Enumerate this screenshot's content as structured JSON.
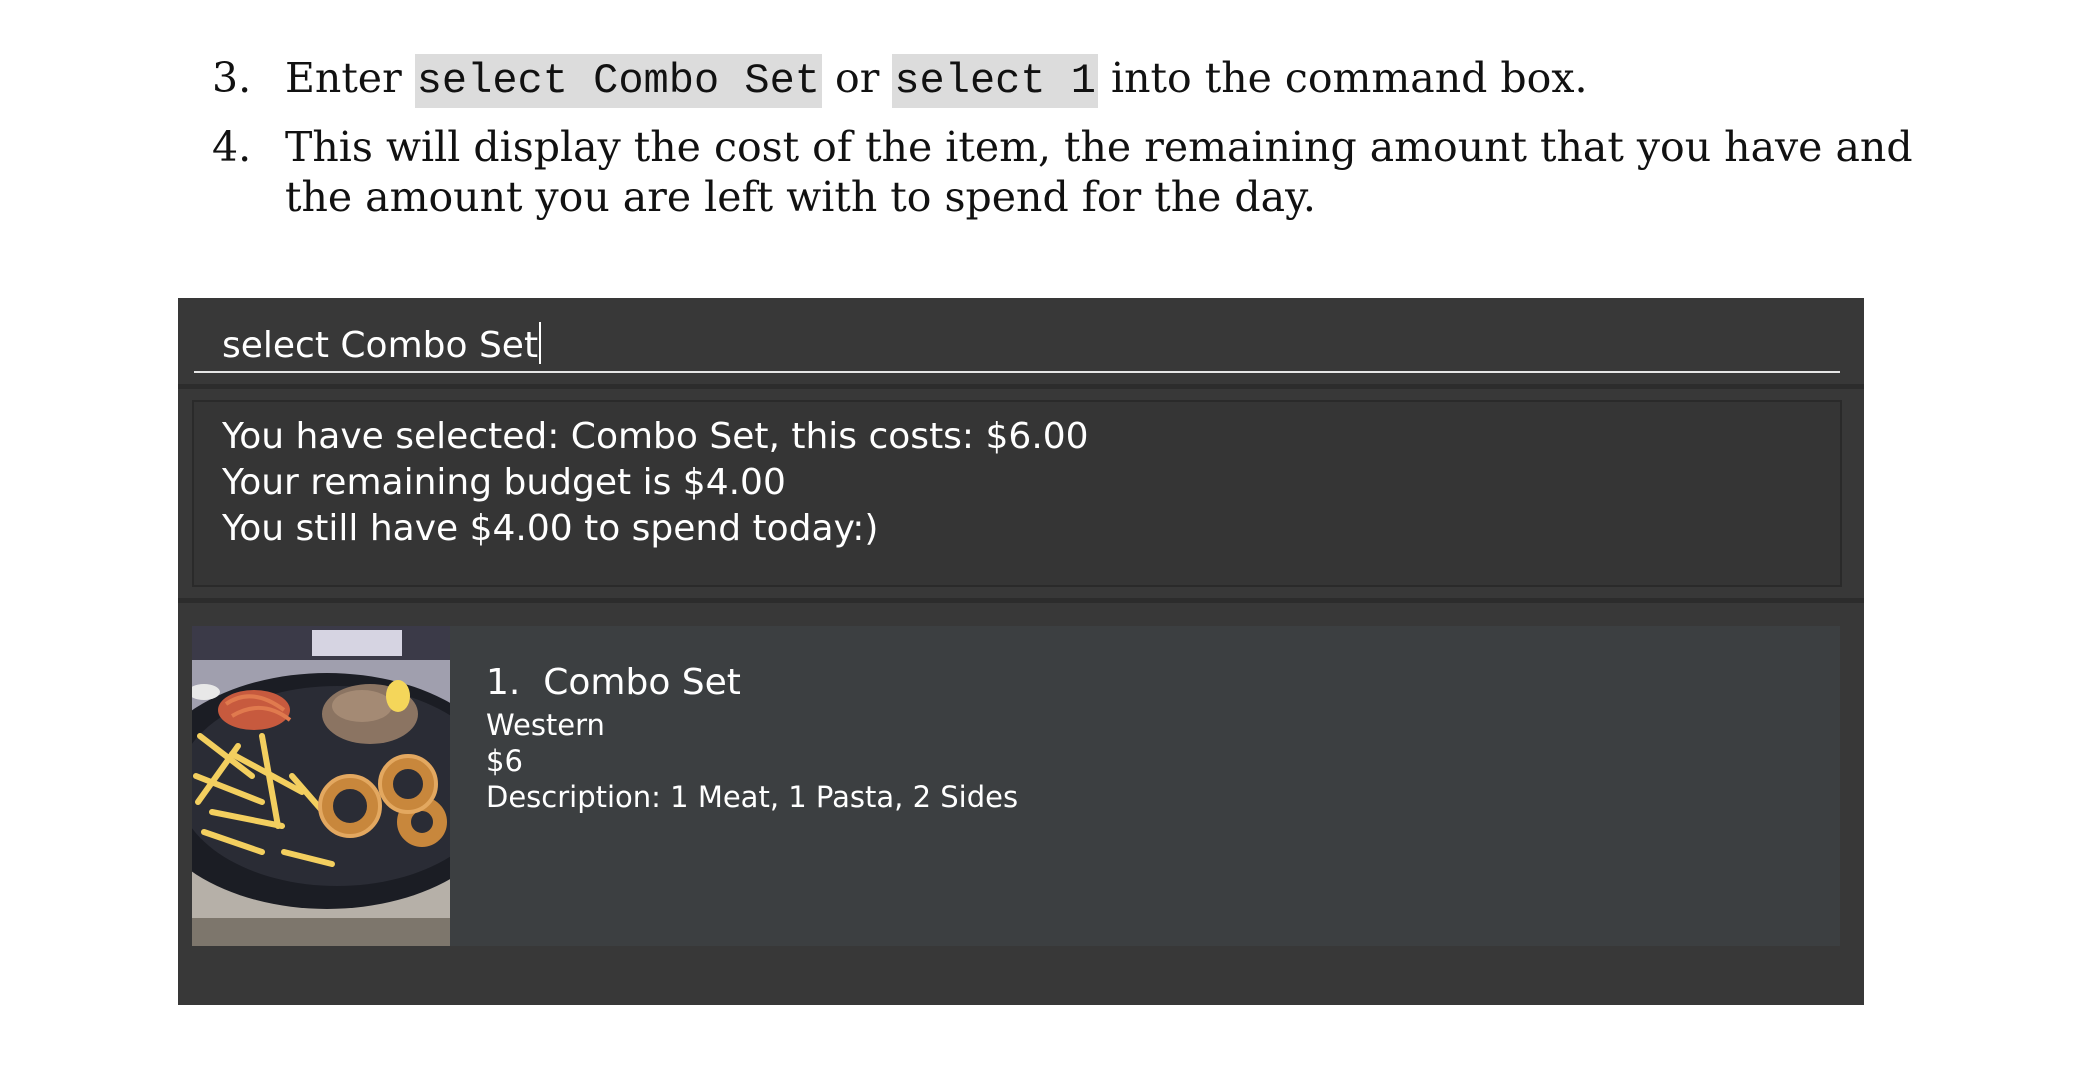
{
  "instructions": {
    "step3": {
      "number": "3.",
      "prefix": "Enter ",
      "code1": "select Combo Set",
      "middle": " or ",
      "code2": "select 1",
      "suffix": " into the command box."
    },
    "step4": {
      "number": "4.",
      "text": "This will display the cost of the item, the remaining amount that you have and the amount you are left with to spend for the day."
    }
  },
  "app": {
    "command_value": "select Combo Set",
    "result_lines": [
      "You have selected: Combo Set, this costs: $6.00",
      "Your remaining budget is $4.00",
      "You still have $4.00 to spend today:)"
    ],
    "item": {
      "title": "1.  Combo Set",
      "cuisine": "Western",
      "price": "$6",
      "description": "Description: 1 Meat, 1 Pasta, 2 Sides",
      "image_icon": "food-photo-icon"
    },
    "colors": {
      "window_bg": "#383838",
      "panel_bg": "#3c3f41",
      "text": "#ffffff",
      "code_bg": "#dcdcdc"
    }
  }
}
